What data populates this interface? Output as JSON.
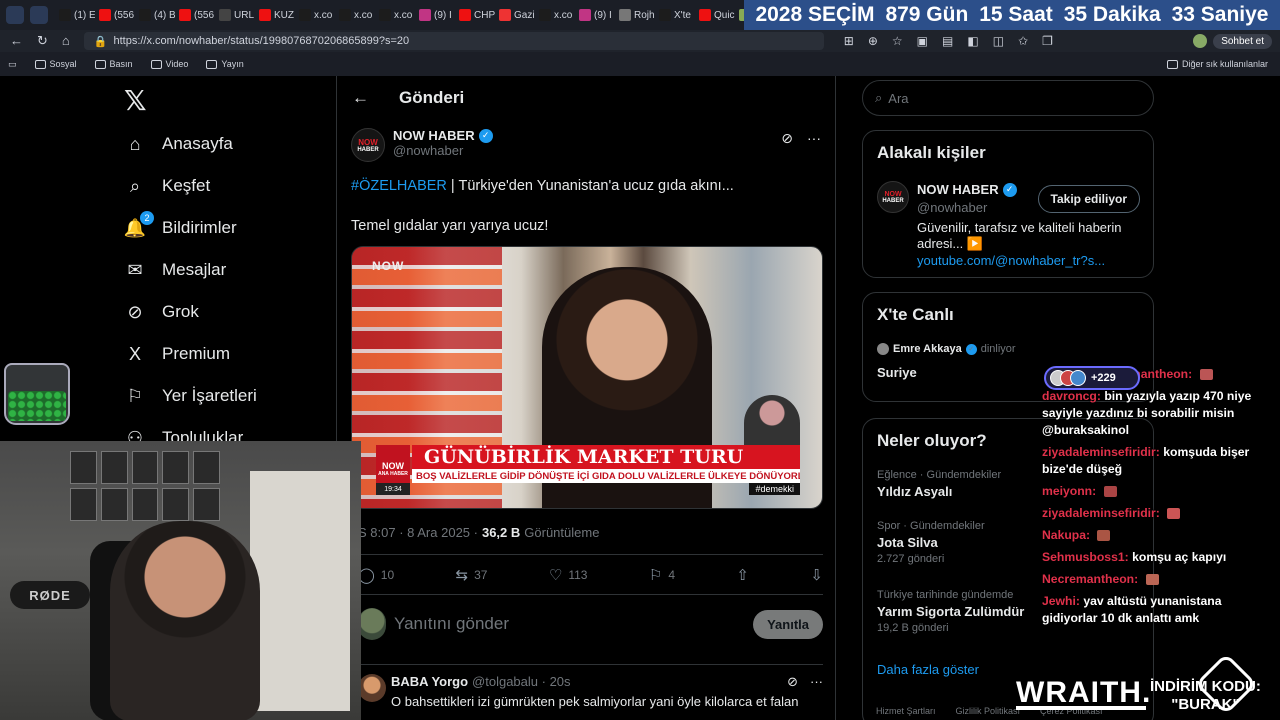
{
  "browser": {
    "tabs": [
      {
        "label": "(1) E",
        "color": "#1c1c1c"
      },
      {
        "label": "(556",
        "color": "#e11"
      },
      {
        "label": "(4) B",
        "color": "#1c1c1c"
      },
      {
        "label": "(556",
        "color": "#e11"
      },
      {
        "label": "URL",
        "color": "#444"
      },
      {
        "label": "KUZ",
        "color": "#e11"
      },
      {
        "label": "x.co",
        "color": "#1c1c1c"
      },
      {
        "label": "x.co",
        "color": "#1c1c1c"
      },
      {
        "label": "x.co",
        "color": "#1c1c1c"
      },
      {
        "label": "(9) I",
        "color": "#c13584"
      },
      {
        "label": "CHP",
        "color": "#e11"
      },
      {
        "label": "Gazi",
        "color": "#e33"
      },
      {
        "label": "x.co",
        "color": "#1c1c1c"
      },
      {
        "label": "(9) I",
        "color": "#c13584"
      },
      {
        "label": "Rojh",
        "color": "#777"
      },
      {
        "label": "X'te",
        "color": "#1c1c1c"
      },
      {
        "label": "Quic",
        "color": "#e11"
      },
      {
        "label": "Lig",
        "color": "#8a5"
      }
    ],
    "url": "https://x.com/nowhaber/status/1998076870206865899?s=20",
    "chat_button": "Sohbet et",
    "bookmarks": [
      "Sosyal",
      "Basın",
      "Video",
      "Yayın"
    ],
    "other_bookmarks": "Diğer sık kullanılanlar"
  },
  "countdown": {
    "year_label": "2028 SEÇİM",
    "days": "879 Gün",
    "hours": "15 Saat",
    "minutes": "35 Dakika",
    "seconds": "33 Saniye"
  },
  "sidebar": {
    "items": [
      {
        "label": "Anasayfa",
        "icon": "home-icon",
        "glyph": "⌂"
      },
      {
        "label": "Keşfet",
        "icon": "search-icon",
        "glyph": "⌕"
      },
      {
        "label": "Bildirimler",
        "icon": "bell-icon",
        "glyph": "🔔"
      },
      {
        "label": "Mesajlar",
        "icon": "mail-icon",
        "glyph": "✉"
      },
      {
        "label": "Grok",
        "icon": "grok-icon",
        "glyph": "⊘"
      },
      {
        "label": "Premium",
        "icon": "x-premium-icon",
        "glyph": "X"
      },
      {
        "label": "Yer İşaretleri",
        "icon": "bookmark-icon",
        "glyph": "⚐"
      },
      {
        "label": "Topluluklar",
        "icon": "community-icon",
        "glyph": "⚇"
      }
    ],
    "notification_count": "2"
  },
  "post": {
    "header_title": "Gönderi",
    "author_name": "NOW HABER",
    "author_handle": "@nowhaber",
    "hashtag": "#ÖZELHABER",
    "text_line1": " | Türkiye'den Yunanistan'a ucuz gıda akını...",
    "text_line2": "Temel gıdalar yarı yarıya ucuz!",
    "media": {
      "watermark": "NOW",
      "channel_logo_top": "NOW",
      "channel_logo_bottom": "ANA HABER",
      "headline": "GÜNÜBİRLİK MARKET TURU",
      "subheadline": "BOŞ VALİZLERLE GİDİP DÖNÜŞTE İÇİ GIDA DOLU VALİZLERLE ÜLKEYE DÖNÜYORLAR",
      "time": "19:34",
      "tag": "#demekki"
    },
    "meta_time": "S 8:07 · 8 Ara 2025 · ",
    "views": "36,2 B",
    "views_label": "Görüntüleme",
    "stats": {
      "replies": "10",
      "reposts": "37",
      "likes": "113",
      "bookmarks": "4"
    },
    "reply_placeholder": "Yanıtını gönder",
    "reply_button": "Yanıtla",
    "comment": {
      "name": "BABA Yorgo",
      "handle": "@tolgabalu · 20s",
      "text": "O bahsettikleri izi gümrükten pek salmiyorlar yani öyle kilolarca et falan"
    }
  },
  "right": {
    "search_placeholder": "Ara",
    "related_title": "Alakalı kişiler",
    "related": {
      "name": "NOW HABER",
      "handle": "@nowhaber",
      "follow_label": "Takip ediliyor",
      "bio": "Güvenilir, tarafsız ve kaliteli haberin adresi... ▶️",
      "link": "youtube.com/@nowhaber_tr?s..."
    },
    "live_title": "X'te Canlı",
    "live": {
      "host": "Emre Akkaya",
      "status": "dinliyor",
      "topic": "Suriye"
    },
    "trends_title": "Neler oluyor?",
    "trends": [
      {
        "category": "Eğlence · Gündemdekiler",
        "name": "Yıldız Asyalı",
        "count": ""
      },
      {
        "category": "Spor · Gündemdekiler",
        "name": "Jota Silva",
        "count": "2.727 gönderi"
      },
      {
        "category": "Türkiye tarihinde gündemde",
        "name": "Yarım Sigorta Zulümdür",
        "count": "19,2 B gönderi"
      }
    ],
    "show_more": "Daha fazla göster",
    "footer": [
      "Hizmet Şartları",
      "Gizlilik Politikası",
      "Çerez Politikası"
    ]
  },
  "stream": {
    "mic_brand": "RØDE",
    "viewer_count": "+229",
    "chat": [
      {
        "user": "Necremantheon:",
        "text": ""
      },
      {
        "user": "davroncg:",
        "text": "bin yazıyla yazıp 470 niye sayiyle yazdınız bi sorabilir misin @buraksakinol"
      },
      {
        "user": "ziyadaleminsefiridir:",
        "text": "komşuda bişer bize'de düşeğ"
      },
      {
        "user": "meiyonn:",
        "text": ""
      },
      {
        "user": "ziyadaleminsefiridir:",
        "text": ""
      },
      {
        "user": "Nakupa:",
        "text": ""
      },
      {
        "user": "Sehmusboss1:",
        "text": "komşu aç kapıyı"
      },
      {
        "user": "Necremantheon:",
        "text": ""
      },
      {
        "user": "Jewhi:",
        "text": "yav altüstü yunanistana gidiyorlar 10 dk anlattı amk"
      }
    ],
    "sponsor": "WRAITH.",
    "promo_line1": "İNDİRİM KODU:",
    "promo_line2": "\"BURAK\""
  }
}
